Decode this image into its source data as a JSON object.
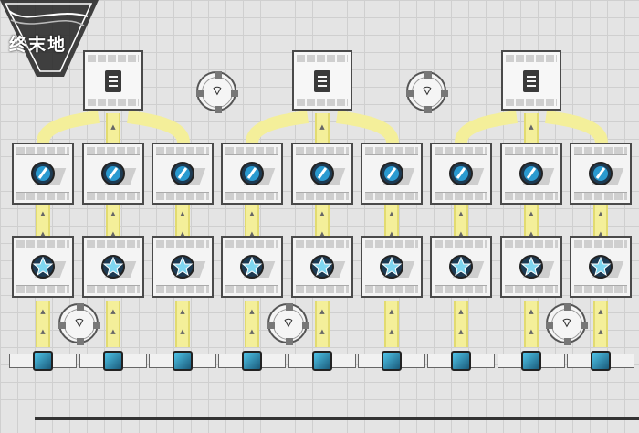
{
  "logo": {
    "text": "终末地"
  },
  "storage_icon": "document-icon",
  "relay_icon": "signal-relay-icon",
  "ore_icon": "ore-crystal-icon",
  "gem_icon": "star-crystal-icon",
  "port_icon": "cube-icon",
  "colors": {
    "belt": "#f4ef9a",
    "grid": "#e4e4e4",
    "ore": "#2a9ad0"
  }
}
